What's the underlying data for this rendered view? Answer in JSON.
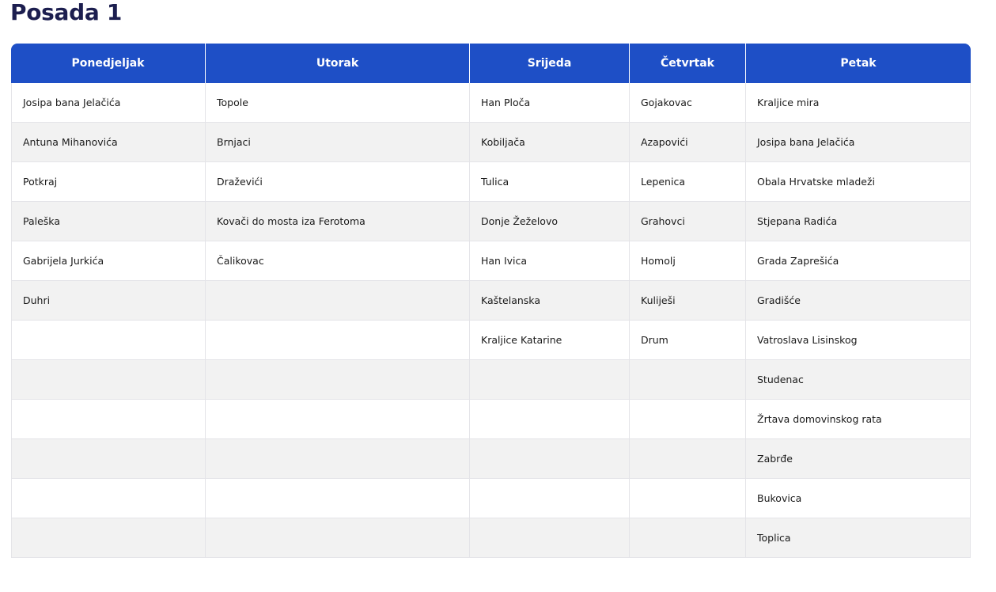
{
  "page": {
    "title": "Posada 1"
  },
  "colors": {
    "header_bg": "#1e4fc6",
    "header_text": "#ffffff",
    "title_text": "#1c1e4f",
    "row_alt_bg": "#f2f2f2"
  },
  "schedule": {
    "headers": [
      "Ponedjeljak",
      "Utorak",
      "Srijeda",
      "Četvrtak",
      "Petak"
    ],
    "rows": [
      [
        "Josipa bana Jelačića",
        "Topole",
        "Han Ploča",
        "Gojakovac",
        "Kraljice mira"
      ],
      [
        "Antuna Mihanovića",
        "Brnjaci",
        "Kobiljača",
        "Azapovići",
        "Josipa bana Jelačića"
      ],
      [
        "Potkraj",
        "Draževići",
        "Tulica",
        "Lepenica",
        "Obala Hrvatske mladeži"
      ],
      [
        "Paleška",
        "Kovači do mosta iza Ferotoma",
        "Donje Žeželovo",
        "Grahovci",
        "Stjepana Radića"
      ],
      [
        "Gabrijela Jurkića",
        "Čalikovac",
        "Han Ivica",
        "Homolj",
        "Grada Zaprešića"
      ],
      [
        "Duhri",
        "",
        "Kaštelanska",
        "Kuliješi",
        "Gradišće"
      ],
      [
        "",
        "",
        "Kraljice Katarine",
        "Drum",
        "Vatroslava Lisinskog"
      ],
      [
        "",
        "",
        "",
        "",
        "Studenac"
      ],
      [
        "",
        "",
        "",
        "",
        "Žrtava domovinskog rata"
      ],
      [
        "",
        "",
        "",
        "",
        "Zabrđe"
      ],
      [
        "",
        "",
        "",
        "",
        "Bukovica"
      ],
      [
        "",
        "",
        "",
        "",
        "Toplica"
      ]
    ]
  }
}
